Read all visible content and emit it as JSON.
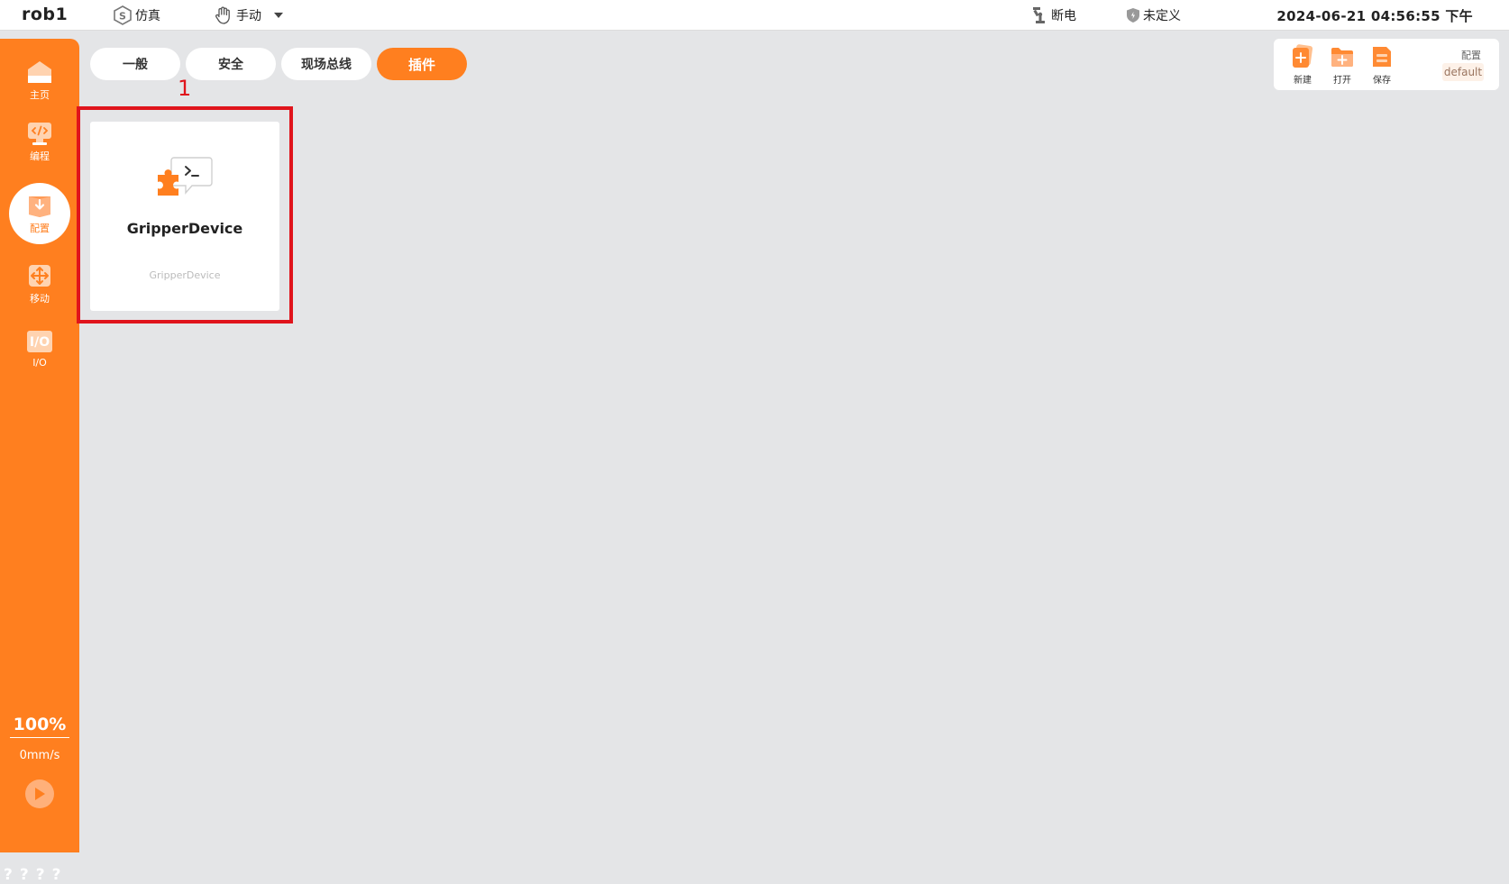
{
  "topbar": {
    "robot_name": "rob1",
    "sim_label": "仿真",
    "mode_label": "手动",
    "power_label": "断电",
    "safety_label": "未定义",
    "datetime": "2024-06-21 04:56:55 下午"
  },
  "sidebar": {
    "items": [
      {
        "label": "主页",
        "icon": "home-icon"
      },
      {
        "label": "编程",
        "icon": "code-icon"
      },
      {
        "label": "配置",
        "icon": "config-icon",
        "active": true
      },
      {
        "label": "移动",
        "icon": "move-icon"
      },
      {
        "label": "I/O",
        "icon": "io-icon"
      }
    ],
    "speed_percent": "100%",
    "speed_mm": "0mm/s",
    "footer_marks": "????"
  },
  "tabs": [
    {
      "label": "一般",
      "active": false
    },
    {
      "label": "安全",
      "active": false
    },
    {
      "label": "现场总线",
      "active": false
    },
    {
      "label": "插件",
      "active": true
    }
  ],
  "annotation": {
    "number": "1"
  },
  "plugins": [
    {
      "name": "GripperDevice",
      "subtitle": "GripperDevice",
      "icon": "plugin-puzzle-icon"
    }
  ],
  "config_panel": {
    "title": "配置",
    "value": "default",
    "buttons": [
      {
        "label": "新建",
        "icon": "new-file-icon"
      },
      {
        "label": "打开",
        "icon": "open-folder-icon"
      },
      {
        "label": "保存",
        "icon": "save-icon"
      }
    ]
  },
  "colors": {
    "accent": "#ff7f1f",
    "background": "#e4e5e7",
    "annotation": "#e0141c"
  }
}
